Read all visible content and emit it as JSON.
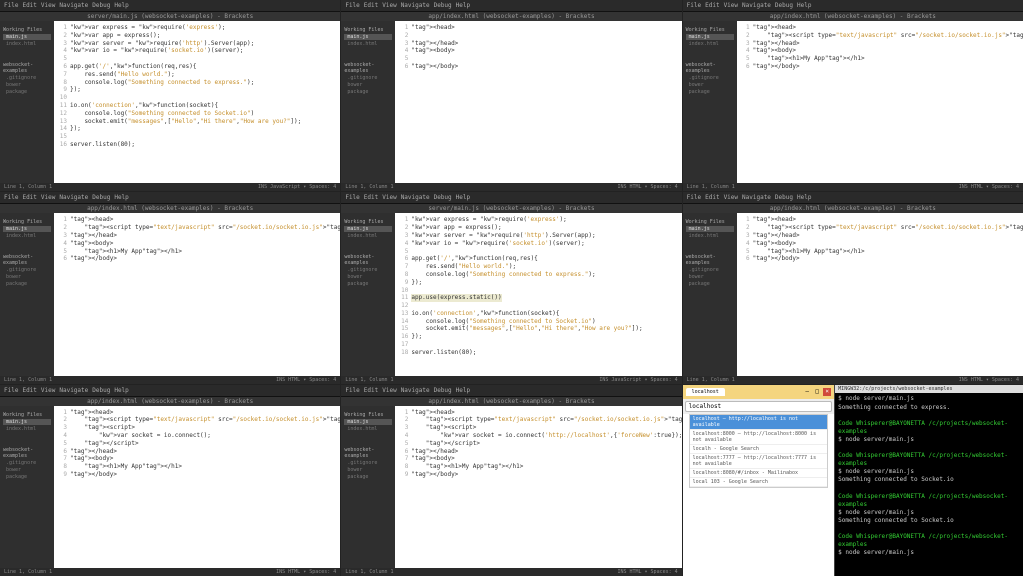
{
  "menus": [
    "File",
    "Edit",
    "View",
    "Navigate",
    "Debug",
    "Help"
  ],
  "titles": {
    "p1": "server/main.js (websocket-examples) - Brackets",
    "p2": "app/index.html (websocket-examples) - Brackets",
    "p3": "app/index.html (websocket-examples) - Brackets",
    "p4": "app/index.html (websocket-examples) - Brackets",
    "p5": "server/main.js (websocket-examples) - Brackets",
    "p6": "app/index.html (websocket-examples) - Brackets",
    "p7": "app/index.html (websocket-examples) - Brackets",
    "p8": "app/index.html (websocket-examples) - Brackets"
  },
  "sidebar": {
    "working": "Working Files",
    "items": [
      "main.js",
      "index.html"
    ],
    "proj": "websocket-examples",
    "folders": [
      ".gitignore",
      "bower",
      "package"
    ]
  },
  "status": {
    "left": "Line 1, Column 1",
    "rightJS": "INS  JavaScript ▾  Spaces: 4",
    "rightHTML": "INS  HTML ▾  Spaces: 4"
  },
  "code": {
    "p1": [
      "var express = require('express');",
      "var app = express();",
      "var server = require('http').Server(app);",
      "var io = require('socket.io')(server);",
      "",
      "app.get('/',function(req,res){",
      "    res.send(\"Hello world.\");",
      "    console.log(\"Something connected to express.\");",
      "});",
      "",
      "io.on('connection',function(socket){",
      "    console.log(\"Something connected to Socket.io\")",
      "    socket.emit(\"messages\",[\"Hello\",\"Hi there\",\"How are you?\"]);",
      "});",
      "",
      "server.listen(80);"
    ],
    "p2": [
      "<head>",
      "",
      "</head>",
      "<body>",
      "",
      "</body>"
    ],
    "p3": [
      "<head>",
      "    <script type=\"text/javascript\" src=\"/socket.io/socket.io.js\"></script>",
      "</head>",
      "<body>",
      "    <h1>My App</h1>",
      "</body>"
    ],
    "p5": [
      "var express = require('express');",
      "var app = express();",
      "var server = require('http').Server(app);",
      "var io = require('socket.io')(server);",
      "",
      "app.get('/',function(req,res){",
      "    res.send(\"Hello world.\");",
      "    console.log(\"Something connected to express.\");",
      "});",
      "",
      "app.use(express.static())",
      "",
      "io.on('connection',function(socket){",
      "    console.log(\"Something connected to Socket.io\")",
      "    socket.emit(\"messages\",[\"Hello\",\"Hi there\",\"How are you?\"]);",
      "});",
      "",
      "server.listen(80);"
    ],
    "p7": [
      "<head>",
      "    <script type=\"text/javascript\" src=\"/socket.io/socket.io.js\"></script>",
      "    <script>",
      "        var socket = io.connect();",
      "    </script>",
      "</head>",
      "<body>",
      "    <h1>My App</h1>",
      "</body>"
    ],
    "p8": [
      "<head>",
      "    <script type=\"text/javascript\" src=\"/socket.io/socket.io.js\"></script>",
      "    <script>",
      "        var socket = io.connect('http://localhost',{'forceNew':true});",
      "    </script>",
      "</head>",
      "<body>",
      "    <h1>My App</h1>",
      "</body>"
    ]
  },
  "browser": {
    "tab": "localhost",
    "url": "localhost",
    "sugg": [
      "localhost — http://localhost is not available",
      "localhost:8000 — http://localhost:8000 is not available",
      "localh - Google Search",
      "localhost:7777 — http://localhost:7777 is not available",
      "localhost:8080/#/inbox - Mailinabox",
      "local 103 - Google Search"
    ]
  },
  "term": {
    "title": "MINGW32:/c/projects/websocket-examples",
    "lines": [
      {
        "c": "",
        "t": "$ node server/main.js"
      },
      {
        "c": "",
        "t": "Something connected to express."
      },
      {
        "c": "",
        "t": ""
      },
      {
        "c": "gr",
        "t": "Code Whisperer@BAYONETTA /c/projects/websocket-examples"
      },
      {
        "c": "",
        "t": "$ node server/main.js"
      },
      {
        "c": "",
        "t": ""
      },
      {
        "c": "gr",
        "t": "Code Whisperer@BAYONETTA /c/projects/websocket-examples"
      },
      {
        "c": "",
        "t": "$ node server/main.js"
      },
      {
        "c": "",
        "t": "Something connected to Socket.io"
      },
      {
        "c": "",
        "t": ""
      },
      {
        "c": "gr",
        "t": "Code Whisperer@BAYONETTA /c/projects/websocket-examples"
      },
      {
        "c": "",
        "t": "$ node server/main.js"
      },
      {
        "c": "",
        "t": "Something connected to Socket.io"
      },
      {
        "c": "",
        "t": ""
      },
      {
        "c": "gr",
        "t": "Code Whisperer@BAYONETTA /c/projects/websocket-examples"
      },
      {
        "c": "",
        "t": "$ node server/main.js"
      }
    ]
  }
}
